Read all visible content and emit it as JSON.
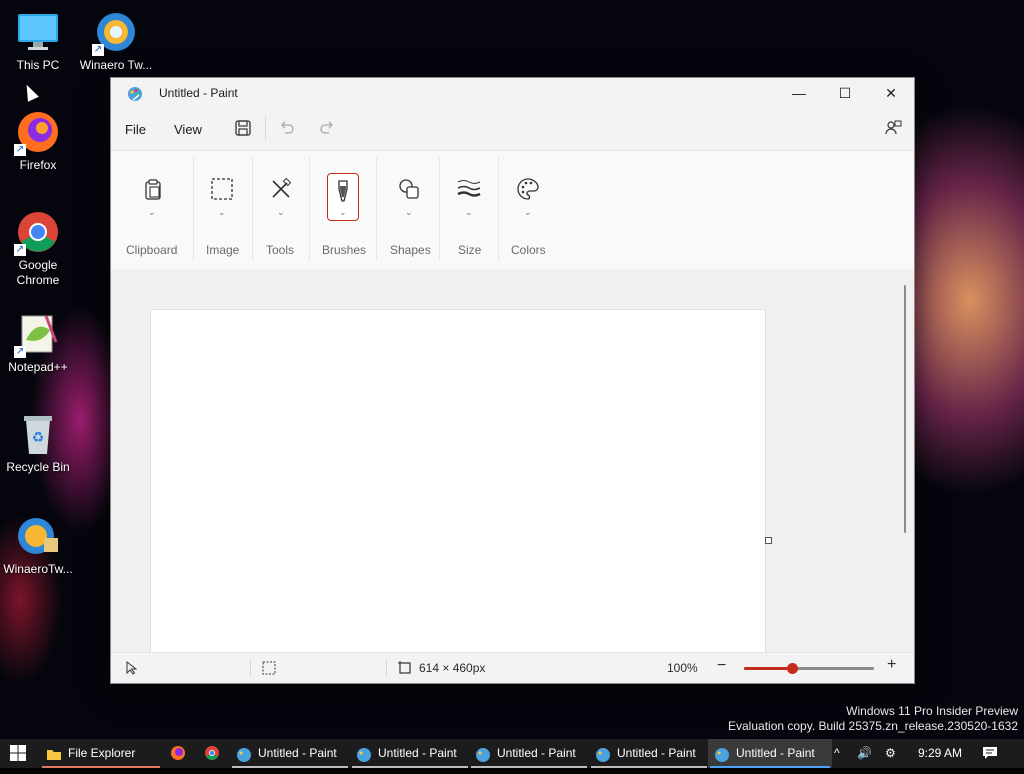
{
  "desktop": {
    "icons": [
      {
        "label": "This PC"
      },
      {
        "label": "Winaero Tw..."
      },
      {
        "label": "Firefox"
      },
      {
        "label": "Google Chrome"
      },
      {
        "label": "Notepad++"
      },
      {
        "label": "Recycle Bin"
      },
      {
        "label": "WinaeroTw..."
      }
    ]
  },
  "window": {
    "title": "Untitled - Paint",
    "controls": {
      "minimize": "—",
      "maximize": "☐",
      "close": "✕"
    }
  },
  "menu": {
    "file": "File",
    "view": "View"
  },
  "ribbon": {
    "groups": [
      {
        "label": "Clipboard",
        "icon": "clipboard-icon"
      },
      {
        "label": "Image",
        "icon": "selection-icon"
      },
      {
        "label": "Tools",
        "icon": "tools-icon"
      },
      {
        "label": "Brushes",
        "icon": "brush-icon"
      },
      {
        "label": "Shapes",
        "icon": "shapes-icon"
      },
      {
        "label": "Size",
        "icon": "size-icon"
      },
      {
        "label": "Colors",
        "icon": "palette-icon"
      }
    ],
    "active_group": "Brushes",
    "accent": "#c42b1c"
  },
  "statusbar": {
    "canvas_size": "614 × 460px",
    "zoom": "100%",
    "zoom_level": 0.37
  },
  "watermark": {
    "line1": "Windows 11 Pro Insider Preview",
    "line2": "Evaluation copy. Build 25375.zn_release.230520-1632"
  },
  "taskbar": {
    "file_explorer": "File Explorer",
    "paint_windows": [
      "Untitled - Paint",
      "Untitled - Paint",
      "Untitled - Paint",
      "Untitled - Paint",
      "Untitled - Paint"
    ],
    "clock": "9:29 AM"
  }
}
